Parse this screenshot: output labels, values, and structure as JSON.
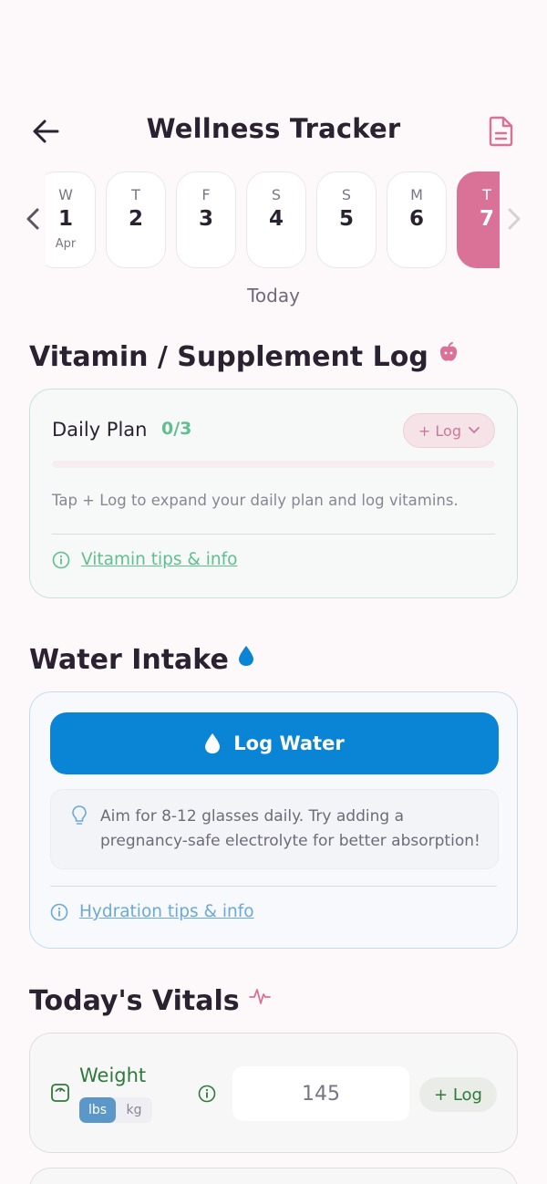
{
  "header": {
    "title": "Wellness Tracker",
    "back_icon": "arrow-left-icon",
    "report_icon": "document-icon"
  },
  "date_strip": {
    "days": [
      {
        "letter": "W",
        "num": "1",
        "month": "Apr",
        "selected": false
      },
      {
        "letter": "T",
        "num": "2",
        "month": "",
        "selected": false
      },
      {
        "letter": "F",
        "num": "3",
        "month": "",
        "selected": false
      },
      {
        "letter": "S",
        "num": "4",
        "month": "",
        "selected": false
      },
      {
        "letter": "S",
        "num": "5",
        "month": "",
        "selected": false
      },
      {
        "letter": "M",
        "num": "6",
        "month": "",
        "selected": false
      },
      {
        "letter": "T",
        "num": "7",
        "month": "",
        "selected": true
      }
    ],
    "today_label": "Today",
    "selected_color": "#d97296"
  },
  "vitamins": {
    "title": "Vitamin / Supplement Log",
    "plan_label": "Daily Plan",
    "plan_count": "0/3",
    "plan_progress": 0,
    "log_button": "+ Log",
    "hint": "Tap + Log to expand your daily plan and log vitamins.",
    "tips_link": "Vitamin tips & info",
    "accent": "#5fbf8e"
  },
  "water": {
    "title": "Water Intake",
    "log_button": "Log Water",
    "tip": "Aim for 8-12 glasses daily. Try adding a pregnancy-safe electrolyte for better absorption!",
    "tips_link": "Hydration tips & info",
    "accent": "#0a84d4"
  },
  "vitals": {
    "title": "Today's Vitals",
    "weight": {
      "label": "Weight",
      "units": [
        "lbs",
        "kg"
      ],
      "selected_unit": "lbs",
      "value": "145",
      "log_button": "+ Log"
    }
  }
}
